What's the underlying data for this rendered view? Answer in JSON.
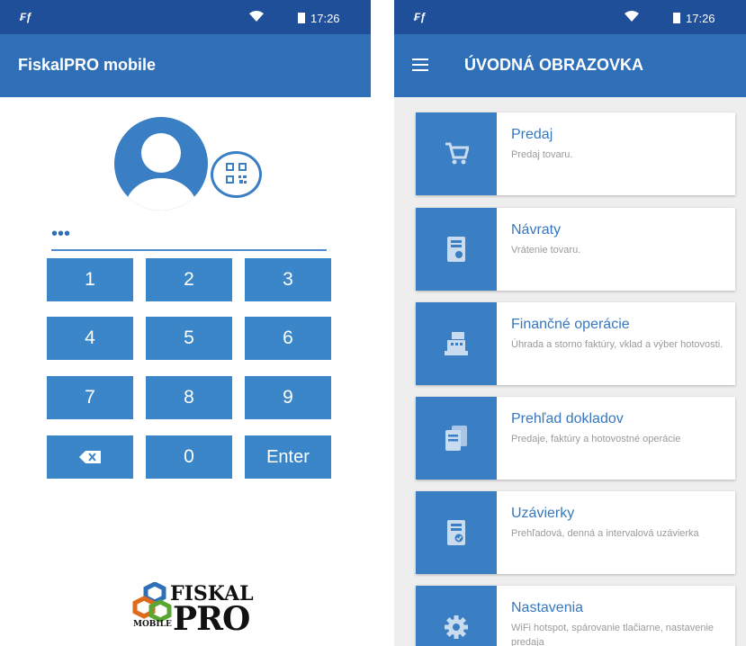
{
  "status": {
    "time": "17:26"
  },
  "login": {
    "app_title": "FiskalPRO mobile",
    "pin_value": "•••",
    "keys": [
      "1",
      "2",
      "3",
      "4",
      "5",
      "6",
      "7",
      "8",
      "9",
      "",
      "0",
      "Enter"
    ],
    "brand": {
      "mobile": "MOBILE",
      "fiskal": "FISKAL",
      "pro": "PRO"
    }
  },
  "home": {
    "title": "ÚVODNÁ OBRAZOVKA",
    "items": [
      {
        "title": "Predaj",
        "desc": "Predaj tovaru.",
        "icon": "cart-icon"
      },
      {
        "title": "Návraty",
        "desc": "Vrátenie tovaru.",
        "icon": "receipt-return-icon"
      },
      {
        "title": "Finančné operácie",
        "desc": "Úhrada a storno faktúry, vklad a výber hotovosti.",
        "icon": "cash-register-icon"
      },
      {
        "title": "Prehľad dokladov",
        "desc": "Predaje, faktúry a hotovostné operácie",
        "icon": "documents-icon"
      },
      {
        "title": "Uzávierky",
        "desc": "Prehľadová, denná a intervalová uzávierka",
        "icon": "receipt-check-icon"
      },
      {
        "title": "Nastavenia",
        "desc": "WiFi hotspot, spárovanie tlačiarne, nastavenie predaja",
        "icon": "gear-icon"
      }
    ]
  },
  "colors": {
    "status_bar": "#1e4f98",
    "app_bar": "#2f6fb8",
    "accent": "#3a7ec3",
    "key": "#3a86c8"
  }
}
